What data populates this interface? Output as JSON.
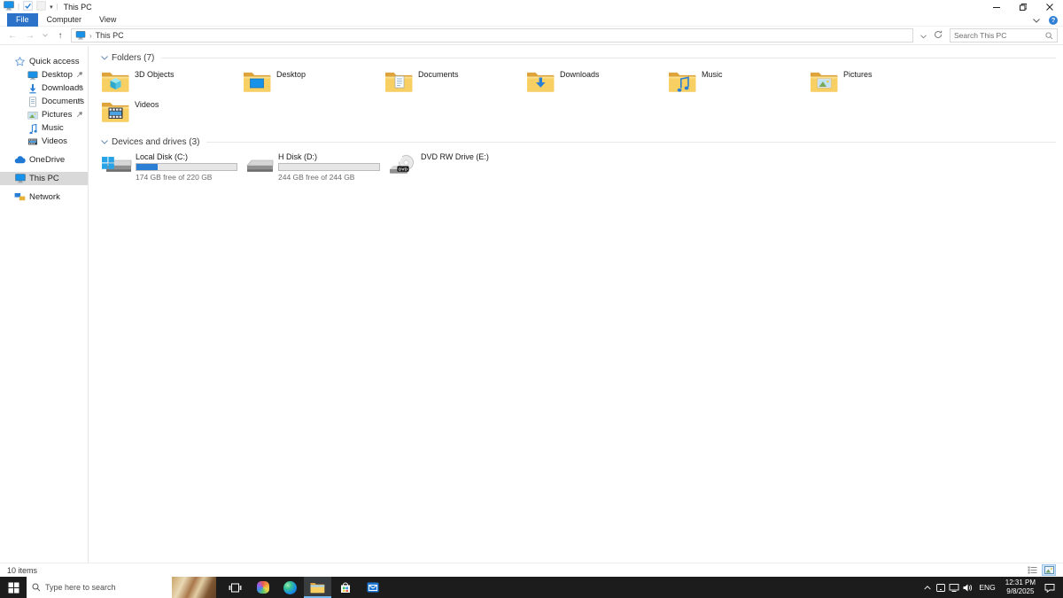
{
  "window": {
    "title": "This PC",
    "controls": {
      "minimize": "minimize",
      "restore": "restore",
      "close": "close"
    }
  },
  "menu": {
    "tabs": [
      {
        "label": "File",
        "active": true
      },
      {
        "label": "Computer",
        "active": false
      },
      {
        "label": "View",
        "active": false
      }
    ],
    "help_label": "?"
  },
  "address": {
    "breadcrumb": "This PC",
    "search_placeholder": "Search This PC"
  },
  "sidebar": {
    "items": [
      {
        "label": "Quick access",
        "icon": "star-icon",
        "level": 0,
        "pinned": false,
        "selected": false,
        "gap_before": false
      },
      {
        "label": "Desktop",
        "icon": "desktop-icon",
        "level": 1,
        "pinned": true,
        "selected": false,
        "gap_before": false
      },
      {
        "label": "Downloads",
        "icon": "downloads-icon",
        "level": 1,
        "pinned": true,
        "selected": false,
        "gap_before": false
      },
      {
        "label": "Documents",
        "icon": "documents-icon",
        "level": 1,
        "pinned": true,
        "selected": false,
        "gap_before": false
      },
      {
        "label": "Pictures",
        "icon": "pictures-icon",
        "level": 1,
        "pinned": true,
        "selected": false,
        "gap_before": false
      },
      {
        "label": "Music",
        "icon": "music-icon",
        "level": 1,
        "pinned": false,
        "selected": false,
        "gap_before": false
      },
      {
        "label": "Videos",
        "icon": "videos-icon",
        "level": 1,
        "pinned": false,
        "selected": false,
        "gap_before": false
      },
      {
        "label": "OneDrive",
        "icon": "onedrive-icon",
        "level": 0,
        "pinned": false,
        "selected": false,
        "gap_before": true
      },
      {
        "label": "This PC",
        "icon": "thispc-icon",
        "level": 0,
        "pinned": false,
        "selected": true,
        "gap_before": true
      },
      {
        "label": "Network",
        "icon": "network-icon",
        "level": 0,
        "pinned": false,
        "selected": false,
        "gap_before": true
      }
    ]
  },
  "main": {
    "groups": [
      {
        "name": "Folders (7)",
        "type": "folders",
        "items": [
          {
            "label": "3D Objects",
            "icon": "folder-3d-icon"
          },
          {
            "label": "Desktop",
            "icon": "folder-desktop-icon"
          },
          {
            "label": "Documents",
            "icon": "folder-documents-icon"
          },
          {
            "label": "Downloads",
            "icon": "folder-downloads-icon"
          },
          {
            "label": "Music",
            "icon": "folder-music-icon"
          },
          {
            "label": "Pictures",
            "icon": "folder-pictures-icon"
          },
          {
            "label": "Videos",
            "icon": "folder-videos-icon"
          }
        ]
      },
      {
        "name": "Devices and drives (3)",
        "type": "drives",
        "items": [
          {
            "label": "Local Disk (C:)",
            "icon": "drive-windows-icon",
            "used_percent": 21,
            "free_label": "174 GB free of 220 GB"
          },
          {
            "label": "H Disk (D:)",
            "icon": "drive-icon",
            "used_percent": 0,
            "free_label": "244 GB free of 244 GB"
          },
          {
            "label": "DVD RW Drive (E:)",
            "icon": "dvd-drive-icon",
            "used_percent": null,
            "free_label": null
          }
        ]
      }
    ]
  },
  "statusbar": {
    "items_count": "10 items"
  },
  "taskbar": {
    "search_placeholder": "Type here to search",
    "apps": [
      {
        "name": "task-view",
        "icon": "task-view-icon",
        "active": false
      },
      {
        "name": "copilot",
        "icon": "copilot-icon",
        "active": false
      },
      {
        "name": "edge",
        "icon": "edge-icon",
        "active": false
      },
      {
        "name": "file-explorer",
        "icon": "file-explorer-icon",
        "active": true
      },
      {
        "name": "store",
        "icon": "store-icon",
        "active": false
      },
      {
        "name": "mail",
        "icon": "mail-icon",
        "active": false
      }
    ],
    "tray": {
      "icons": [
        "chevron-up-icon",
        "tablet-icon",
        "network-tray-icon",
        "volume-icon"
      ],
      "lang": "ENG",
      "time": "12:31 PM",
      "date": "9/8/2025"
    }
  },
  "colors": {
    "accent_blue": "#2b72c8",
    "drive_bar_fill": "#2a7fd4",
    "selection_gray": "#d9d9d9",
    "taskbar_bg": "#1c1c1c",
    "folder_yellow": "#f7cf63"
  }
}
